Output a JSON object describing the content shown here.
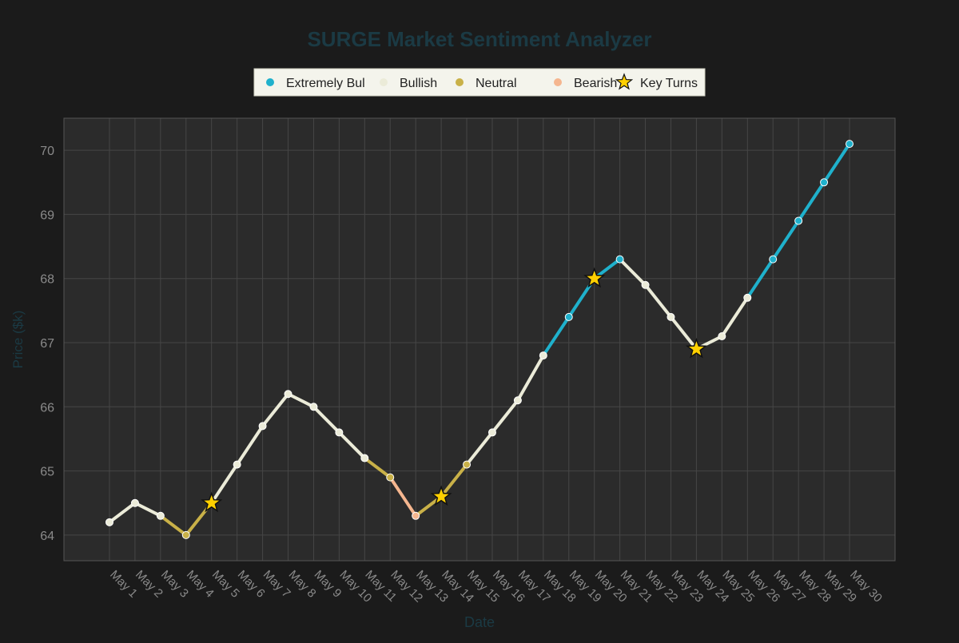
{
  "chart_data": {
    "type": "line",
    "title": "SURGE Market Sentiment Analyzer",
    "xlabel": "Date",
    "ylabel": "Price ($k)",
    "ylim": [
      63.6,
      70.5
    ],
    "yticks": [
      64,
      65,
      66,
      67,
      68,
      69,
      70
    ],
    "grid": true,
    "legend_position": "top-center",
    "categories": [
      "May 1",
      "May 2",
      "May 3",
      "May 4",
      "May 5",
      "May 6",
      "May 7",
      "May 8",
      "May 9",
      "May 10",
      "May 11",
      "May 12",
      "May 13",
      "May 14",
      "May 15",
      "May 16",
      "May 17",
      "May 18",
      "May 19",
      "May 20",
      "May 21",
      "May 22",
      "May 23",
      "May 24",
      "May 25",
      "May 26",
      "May 27",
      "May 28",
      "May 29",
      "May 30"
    ],
    "values": [
      64.2,
      64.5,
      64.3,
      64.0,
      64.5,
      65.1,
      65.7,
      66.2,
      66.0,
      65.6,
      65.2,
      64.9,
      64.3,
      64.6,
      65.1,
      65.6,
      66.1,
      66.8,
      67.4,
      68.0,
      68.3,
      67.9,
      67.4,
      66.9,
      67.1,
      67.7,
      68.3,
      68.9,
      69.5,
      70.1
    ],
    "sentiment": [
      "Bullish",
      "Bullish",
      "Bullish",
      "Neutral",
      "Neutral",
      "Bullish",
      "Bullish",
      "Bullish",
      "Bullish",
      "Bullish",
      "Bullish",
      "Neutral",
      "Bearish",
      "Neutral",
      "Neutral",
      "Bullish",
      "Bullish",
      "Bullish",
      "Extremely Bul",
      "Extremely Bul",
      "Extremely Bul",
      "Bullish",
      "Bullish",
      "Bullish",
      "Bullish",
      "Bullish",
      "Extremely Bul",
      "Extremely Bul",
      "Extremely Bul",
      "Extremely Bul"
    ],
    "key_turns": [
      "May 5",
      "May 14",
      "May 20",
      "May 24"
    ],
    "legend": [
      {
        "label": "Extremely Bul",
        "kind": "dot",
        "color": "#1fb1cc"
      },
      {
        "label": "Bullish",
        "kind": "dot",
        "color": "#ebebd8"
      },
      {
        "label": "Neutral",
        "kind": "dot",
        "color": "#c9b148"
      },
      {
        "label": "Bearish",
        "kind": "dot",
        "color": "#f5b68f"
      },
      {
        "label": "Key Turns",
        "kind": "star",
        "color": "#ffd000"
      }
    ],
    "colors": {
      "Extremely Bul": "#1fb1cc",
      "Bullish": "#ebebd8",
      "Neutral": "#c9b148",
      "Bearish": "#f5b68f",
      "star": "#ffd000",
      "title": "#1b3a44",
      "axis_label": "#1b3a44",
      "tick": "#8a8a8a",
      "plot_bg": "#2b2b2b",
      "grid": "#464646"
    }
  }
}
